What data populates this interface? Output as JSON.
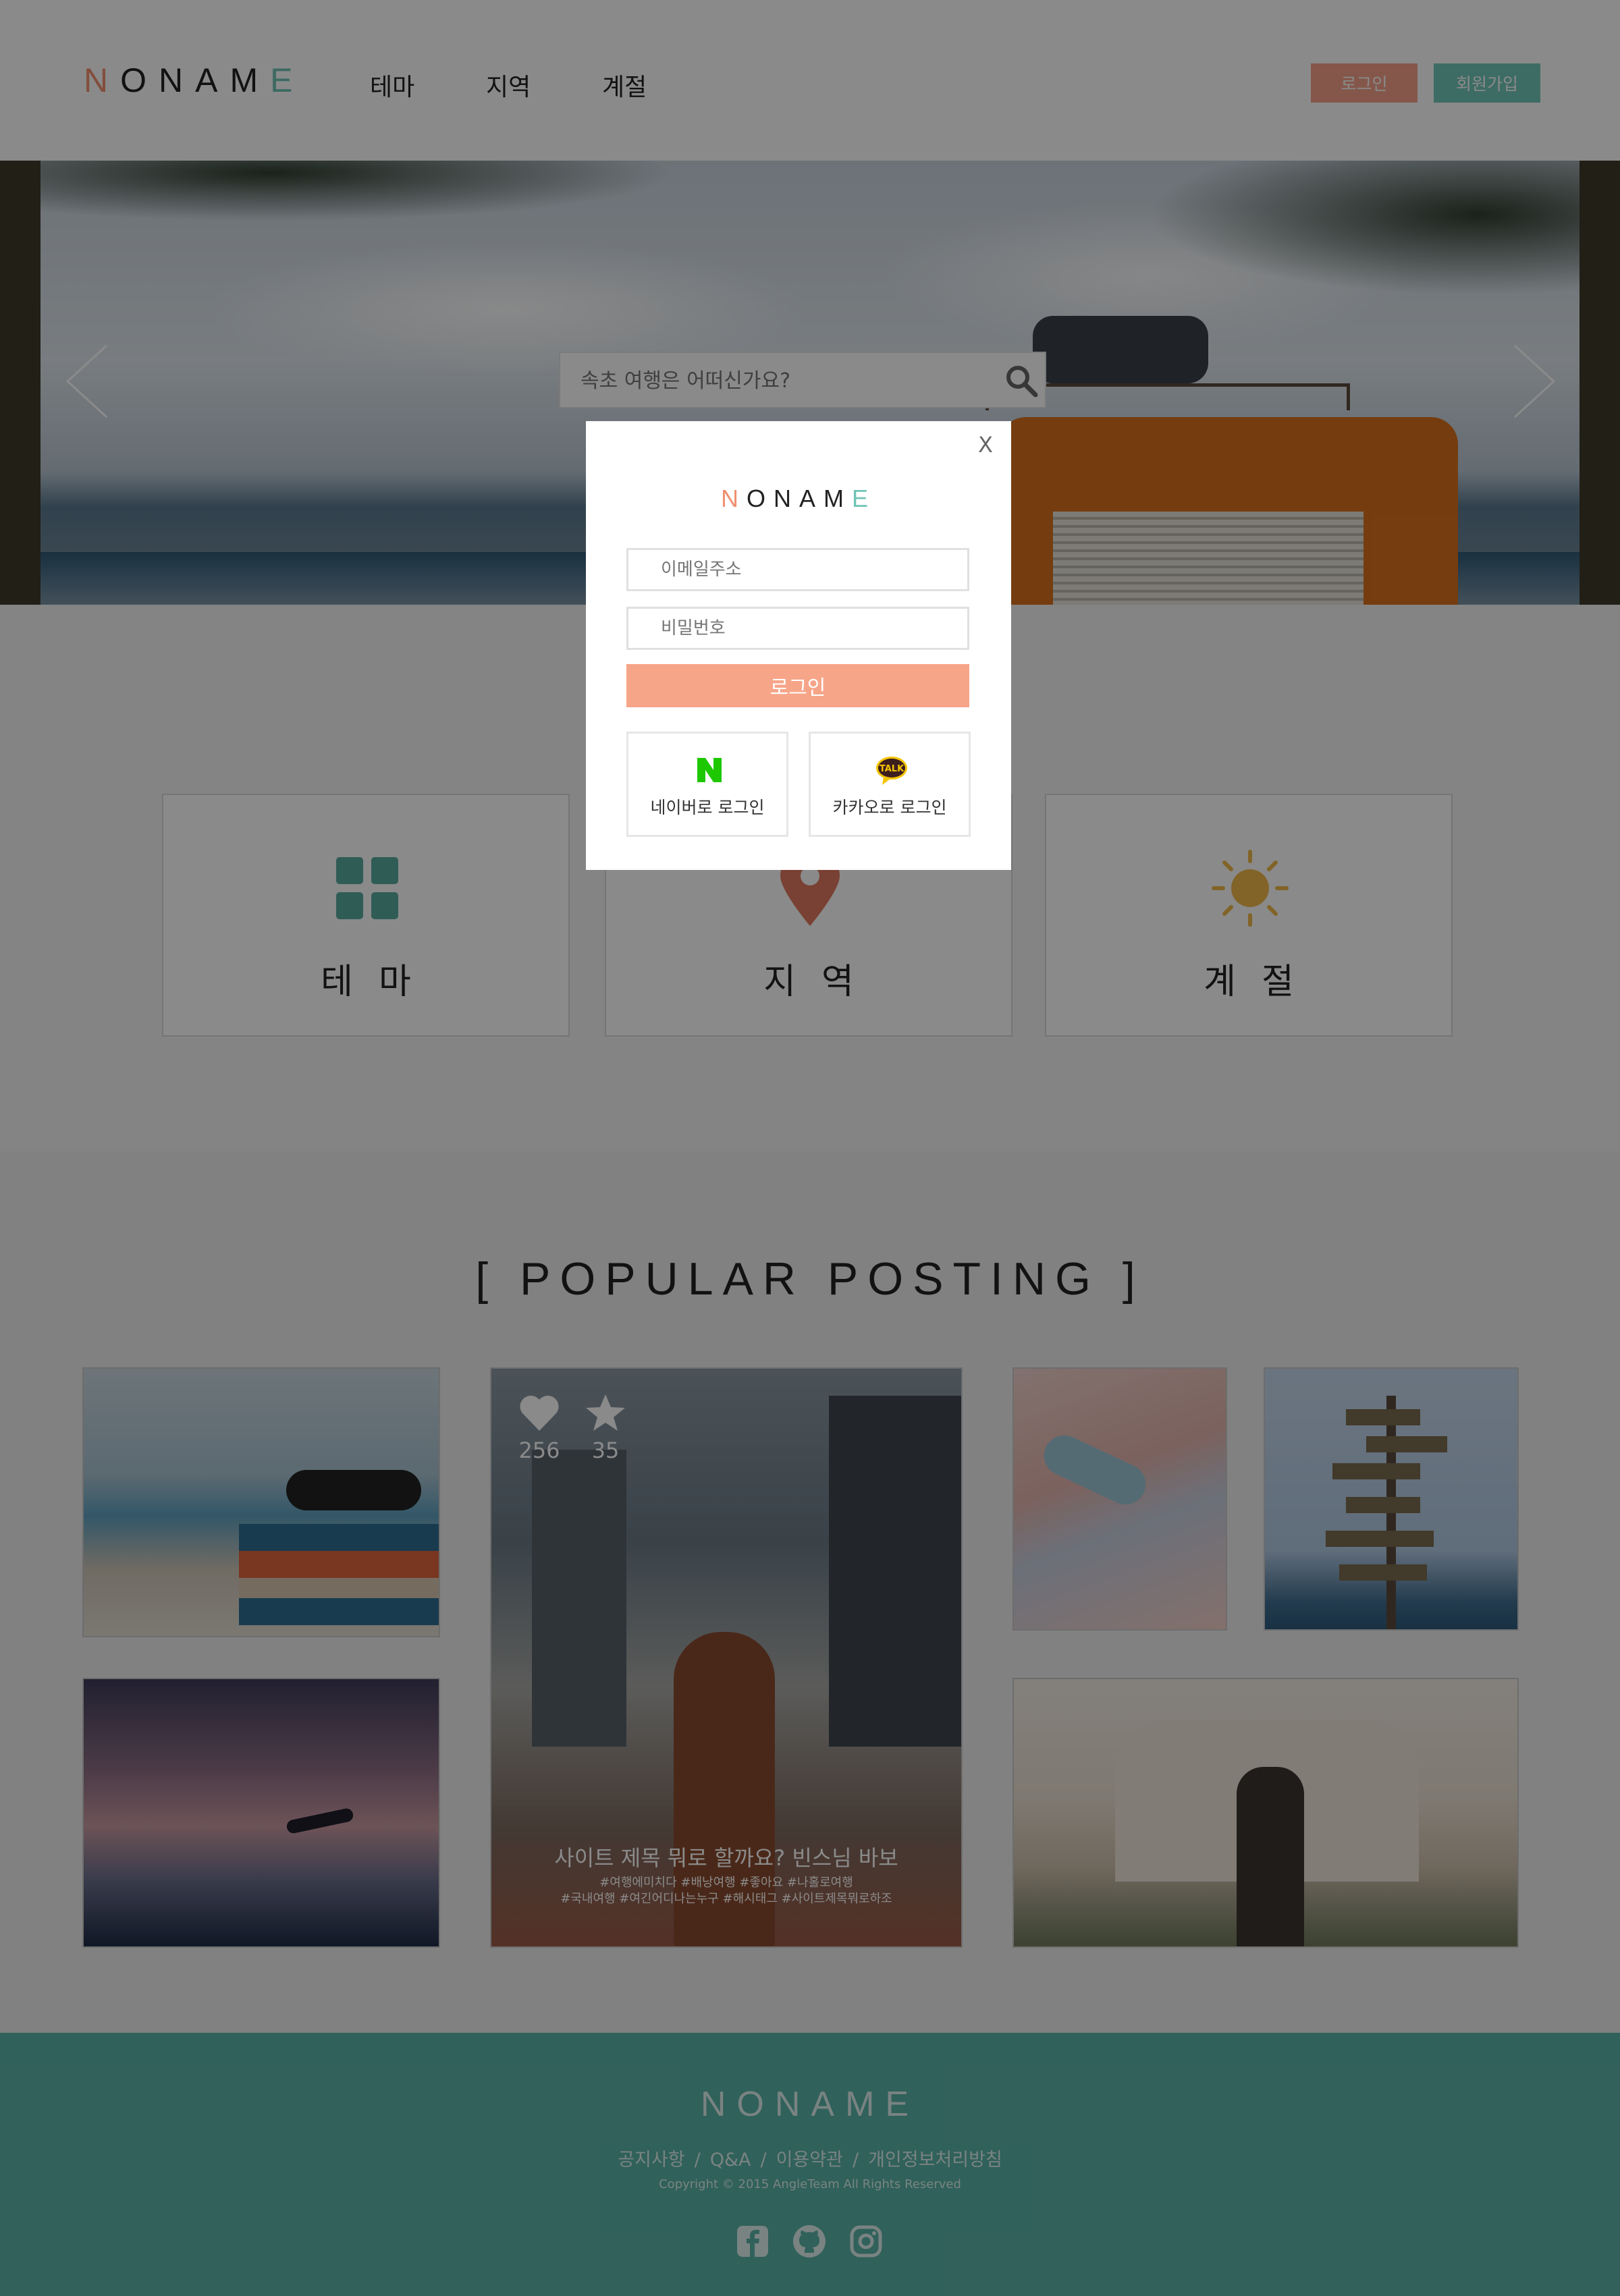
{
  "header": {
    "logo": {
      "n": "N",
      "mid": "ONAM",
      "e": "E"
    },
    "nav": [
      "테마",
      "지역",
      "계절"
    ],
    "login_button": "로그인",
    "signup_button": "회원가입",
    "colors": {
      "login": "#f4a189",
      "signup": "#72c7b9"
    }
  },
  "hero": {
    "search_placeholder": "속초 여행은 어떠신가요?",
    "prev_icon": "chevron-left-icon",
    "next_icon": "chevron-right-icon"
  },
  "categories": [
    {
      "label": "테마",
      "icon": "grid-icon",
      "color": "#5aab9f"
    },
    {
      "label": "지역",
      "icon": "map-pin-icon",
      "color": "#e0785f"
    },
    {
      "label": "계절",
      "icon": "sun-icon",
      "color": "#f1b94a"
    }
  ],
  "popular": {
    "title": "[ POPULAR  POSTING ]",
    "featured": {
      "likes": "256",
      "stars": "35",
      "post_title": "사이트 제목 뭐로 할까요? 빈스님 바보",
      "tags_line1": "#여행에미치다 #배낭여행 #좋아요 #나홀로여행",
      "tags_line2": "#국내여행 #여긴어디나는누구 #해시태그 #사이트제목뭐로하조"
    }
  },
  "footer": {
    "logo": "NONAME",
    "links": [
      "공지사항",
      "Q&A",
      "이용약관",
      "개인정보처리방침"
    ],
    "separator": "/",
    "copyright": "Copyright © 2015 AngleTeam All Rights Reserved",
    "social": [
      "facebook-icon",
      "github-icon",
      "instagram-icon"
    ],
    "color": "#5ab4a6"
  },
  "modal": {
    "close": "X",
    "logo": {
      "n": "N",
      "mid": "ONAM",
      "e": "E"
    },
    "email_placeholder": "이메일주소",
    "password_placeholder": "비밀번호",
    "login_button": "로그인",
    "naver_login": "네이버로 로그인",
    "kakao_login": "카카오로 로그인",
    "kakao_badge": "TALK",
    "naver_badge": "N",
    "colors": {
      "login": "#f7a589",
      "naver": "#1ec800",
      "kakao": "#f5c400"
    }
  }
}
